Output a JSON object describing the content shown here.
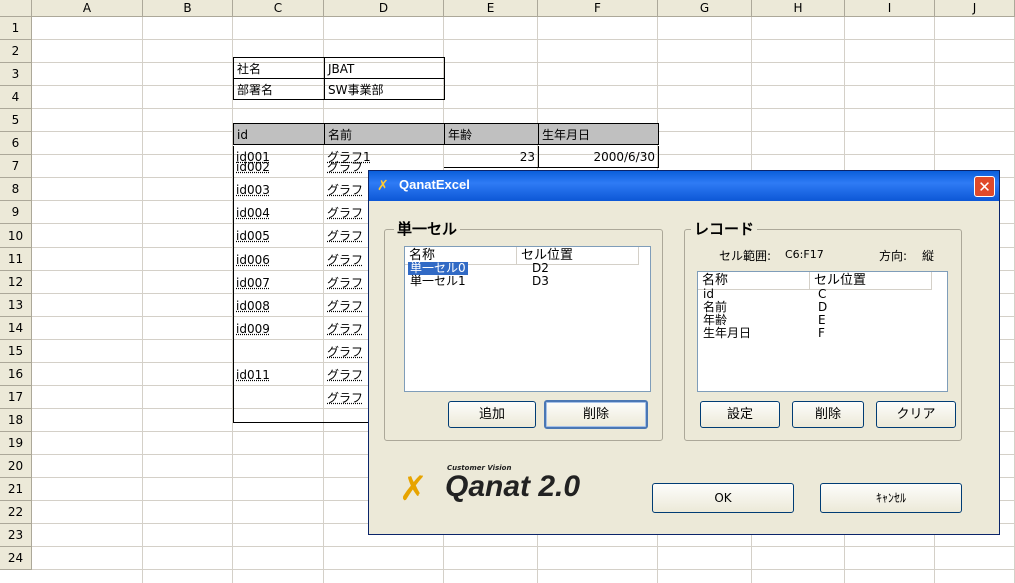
{
  "columns": [
    "A",
    "B",
    "C",
    "D",
    "E",
    "F",
    "G",
    "H",
    "I",
    "J"
  ],
  "rows": [
    "1",
    "2",
    "3",
    "4",
    "5",
    "6",
    "7",
    "8",
    "9",
    "10",
    "11",
    "12",
    "13",
    "14",
    "15",
    "16",
    "17",
    "18",
    "19",
    "20",
    "21",
    "22",
    "23",
    "24"
  ],
  "company": {
    "label": "社名",
    "value": "JBAT"
  },
  "department": {
    "label": "部署名",
    "value": "SW事業部"
  },
  "table": {
    "headers": [
      "id",
      "名前",
      "年齢",
      "生年月日"
    ],
    "first_row": {
      "id": "id001",
      "name": "グラフ1",
      "age": "23",
      "birthday": "2000/6/30"
    },
    "ids": [
      "id002",
      "id003",
      "id004",
      "id005",
      "id006",
      "id007",
      "id008",
      "id009",
      "",
      "id011",
      ""
    ],
    "names_partial": [
      "グラフ",
      "グラフ",
      "グラフ",
      "グラフ",
      "グラフ",
      "グラフ",
      "グラフ",
      "グラフ",
      "グラフ",
      "グラフ",
      "グラフ"
    ]
  },
  "dialog": {
    "title": "QanatExcel",
    "close_label": "✕",
    "single_cell": {
      "title": "単一セル",
      "col_name": "名称",
      "col_pos": "セル位置",
      "items": [
        {
          "name": "単一セル0",
          "pos": "D2",
          "selected": true
        },
        {
          "name": "単一セル1",
          "pos": "D3",
          "selected": false
        }
      ],
      "add_label": "追加",
      "delete_label": "削除"
    },
    "record": {
      "title": "レコード",
      "range_label": "セル範囲:",
      "range_value": "C6:F17",
      "direction_label": "方向:",
      "direction_value": "縦",
      "col_name": "名称",
      "col_pos": "セル位置",
      "items": [
        {
          "name": "id",
          "pos": "C"
        },
        {
          "name": "名前",
          "pos": "D"
        },
        {
          "name": "年齢",
          "pos": "E"
        },
        {
          "name": "生年月日",
          "pos": "F"
        }
      ],
      "settings_label": "設定",
      "delete_label": "削除",
      "clear_label": "クリア"
    },
    "logo": {
      "tagline": "Customer Vision",
      "product": "Qanat 2.0"
    },
    "ok_label": "OK",
    "cancel_label": "ｷｬﾝｾﾙ"
  }
}
